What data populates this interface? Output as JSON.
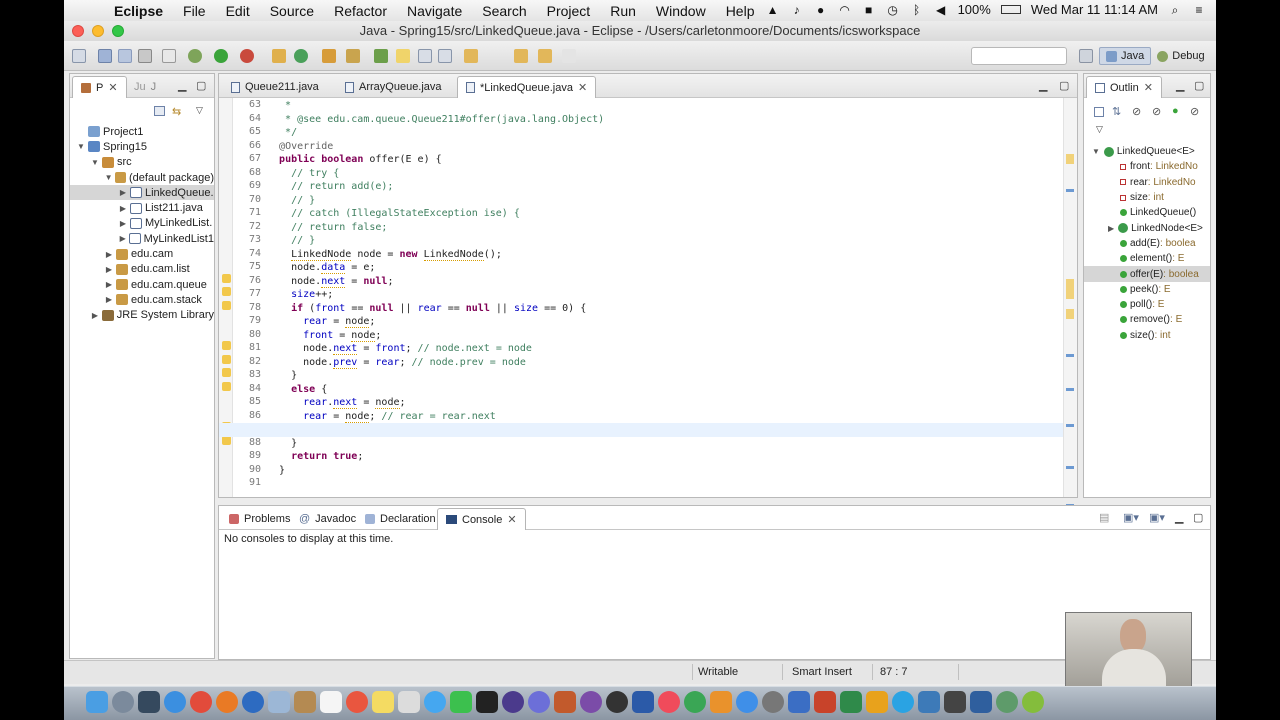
{
  "menubar": {
    "apple_icon": "apple-icon",
    "items": [
      "Eclipse",
      "File",
      "Edit",
      "Source",
      "Refactor",
      "Navigate",
      "Search",
      "Project",
      "Run",
      "Window",
      "Help"
    ],
    "battery": "100%",
    "datetime": "Wed Mar 11  11:14 AM"
  },
  "window": {
    "title": "Java - Spring15/src/LinkedQueue.java - Eclipse - /Users/carletonmoore/Documents/icsworkspace"
  },
  "perspectives": [
    {
      "label": "Java",
      "active": true
    },
    {
      "label": "Debug",
      "active": false
    }
  ],
  "explorer": {
    "tabs": [
      {
        "label": "P"
      },
      {
        "label": "J"
      }
    ],
    "tree": [
      {
        "label": "Project1",
        "depth": 0,
        "twisty": "",
        "icon": "project-folder"
      },
      {
        "label": "Spring15",
        "depth": 0,
        "twisty": "▼",
        "icon": "java-project"
      },
      {
        "label": "src",
        "depth": 1,
        "twisty": "▼",
        "icon": "source-folder"
      },
      {
        "label": "(default package)",
        "depth": 2,
        "twisty": "▼",
        "icon": "package"
      },
      {
        "label": "LinkedQueue.",
        "depth": 3,
        "twisty": "▶",
        "icon": "java-file",
        "selected": true
      },
      {
        "label": "List211.java",
        "depth": 3,
        "twisty": "▶",
        "icon": "java-file"
      },
      {
        "label": "MyLinkedList.",
        "depth": 3,
        "twisty": "▶",
        "icon": "java-file"
      },
      {
        "label": "MyLinkedList1",
        "depth": 3,
        "twisty": "▶",
        "icon": "java-file"
      },
      {
        "label": "edu.cam",
        "depth": 2,
        "twisty": "▶",
        "icon": "package"
      },
      {
        "label": "edu.cam.list",
        "depth": 2,
        "twisty": "▶",
        "icon": "package"
      },
      {
        "label": "edu.cam.queue",
        "depth": 2,
        "twisty": "▶",
        "icon": "package"
      },
      {
        "label": "edu.cam.stack",
        "depth": 2,
        "twisty": "▶",
        "icon": "package"
      },
      {
        "label": "JRE System Library",
        "depth": 1,
        "twisty": "▶",
        "icon": "library"
      }
    ]
  },
  "editor": {
    "tabs": [
      {
        "label": "Queue211.java",
        "active": false
      },
      {
        "label": "ArrayQueue.java",
        "active": false
      },
      {
        "label": "*LinkedQueue.java",
        "active": true
      }
    ],
    "lines": [
      {
        "n": "63",
        "text": "   *"
      },
      {
        "n": "64",
        "text": "   * @see edu.cam.queue.Queue211#offer(java.lang.Object)"
      },
      {
        "n": "65",
        "text": "   */"
      },
      {
        "n": "66",
        "text": "  @Override"
      },
      {
        "n": "67",
        "text": "  public boolean offer(E e) {"
      },
      {
        "n": "68",
        "text": "    // try {"
      },
      {
        "n": "69",
        "text": "    // return add(e);"
      },
      {
        "n": "70",
        "text": "    // }"
      },
      {
        "n": "71",
        "text": "    // catch (IllegalStateException ise) {"
      },
      {
        "n": "72",
        "text": "    // return false;"
      },
      {
        "n": "73",
        "text": "    // }"
      },
      {
        "n": "74",
        "text": "    LinkedNode node = new LinkedNode();"
      },
      {
        "n": "75",
        "text": "    node.data = e;"
      },
      {
        "n": "76",
        "text": "    node.next = null;"
      },
      {
        "n": "77",
        "text": "    size++;"
      },
      {
        "n": "78",
        "text": "    if (front == null || rear == null || size == 0) {"
      },
      {
        "n": "79",
        "text": "      rear = node;"
      },
      {
        "n": "80",
        "text": "      front = node;"
      },
      {
        "n": "81",
        "text": "      node.next = front; // node.next = node"
      },
      {
        "n": "82",
        "text": "      node.prev = rear; // node.prev = node"
      },
      {
        "n": "83",
        "text": "    }"
      },
      {
        "n": "84",
        "text": "    else {"
      },
      {
        "n": "85",
        "text": "      rear.next = node;"
      },
      {
        "n": "86",
        "text": "      rear = node; // rear = rear.next"
      },
      {
        "n": "87",
        "text": ""
      },
      {
        "n": "88",
        "text": "    }"
      },
      {
        "n": "89",
        "text": "    return true;"
      },
      {
        "n": "90",
        "text": "  }"
      },
      {
        "n": "91",
        "text": ""
      }
    ]
  },
  "outline": {
    "tab_label": "Outlin",
    "items": [
      {
        "label": "LinkedQueue<E>",
        "type": "",
        "kind": "class",
        "depth": 0
      },
      {
        "label": "front",
        "type": " : LinkedNo",
        "kind": "field",
        "depth": 1
      },
      {
        "label": "rear",
        "type": " : LinkedNo",
        "kind": "field",
        "depth": 1
      },
      {
        "label": "size",
        "type": " : int",
        "kind": "field",
        "depth": 1
      },
      {
        "label": "LinkedQueue()",
        "type": "",
        "kind": "constructor",
        "depth": 1
      },
      {
        "label": "LinkedNode<E>",
        "type": "",
        "kind": "innerclass",
        "depth": 1
      },
      {
        "label": "add(E)",
        "type": " : boolea",
        "kind": "method",
        "depth": 1
      },
      {
        "label": "element()",
        "type": " : E",
        "kind": "method",
        "depth": 1
      },
      {
        "label": "offer(E)",
        "type": " : boolea",
        "kind": "method",
        "depth": 1,
        "selected": true
      },
      {
        "label": "peek()",
        "type": " : E",
        "kind": "method",
        "depth": 1
      },
      {
        "label": "poll()",
        "type": " : E",
        "kind": "method",
        "depth": 1
      },
      {
        "label": "remove()",
        "type": " : E",
        "kind": "method",
        "depth": 1
      },
      {
        "label": "size()",
        "type": " : int",
        "kind": "method",
        "depth": 1
      }
    ]
  },
  "bottom": {
    "tabs": [
      {
        "label": "Problems",
        "active": false
      },
      {
        "label": "Javadoc",
        "active": false
      },
      {
        "label": "Declaration",
        "active": false
      },
      {
        "label": "Console",
        "active": true
      }
    ],
    "message": "No consoles to display at this time."
  },
  "status": {
    "writable": "Writable",
    "insert_mode": "Smart Insert",
    "position": "87 : 7"
  },
  "colors": {
    "comment": "#3f7f5f",
    "keyword": "#7f0055",
    "field": "#0000c0",
    "current_line": "#e8f2fe"
  }
}
